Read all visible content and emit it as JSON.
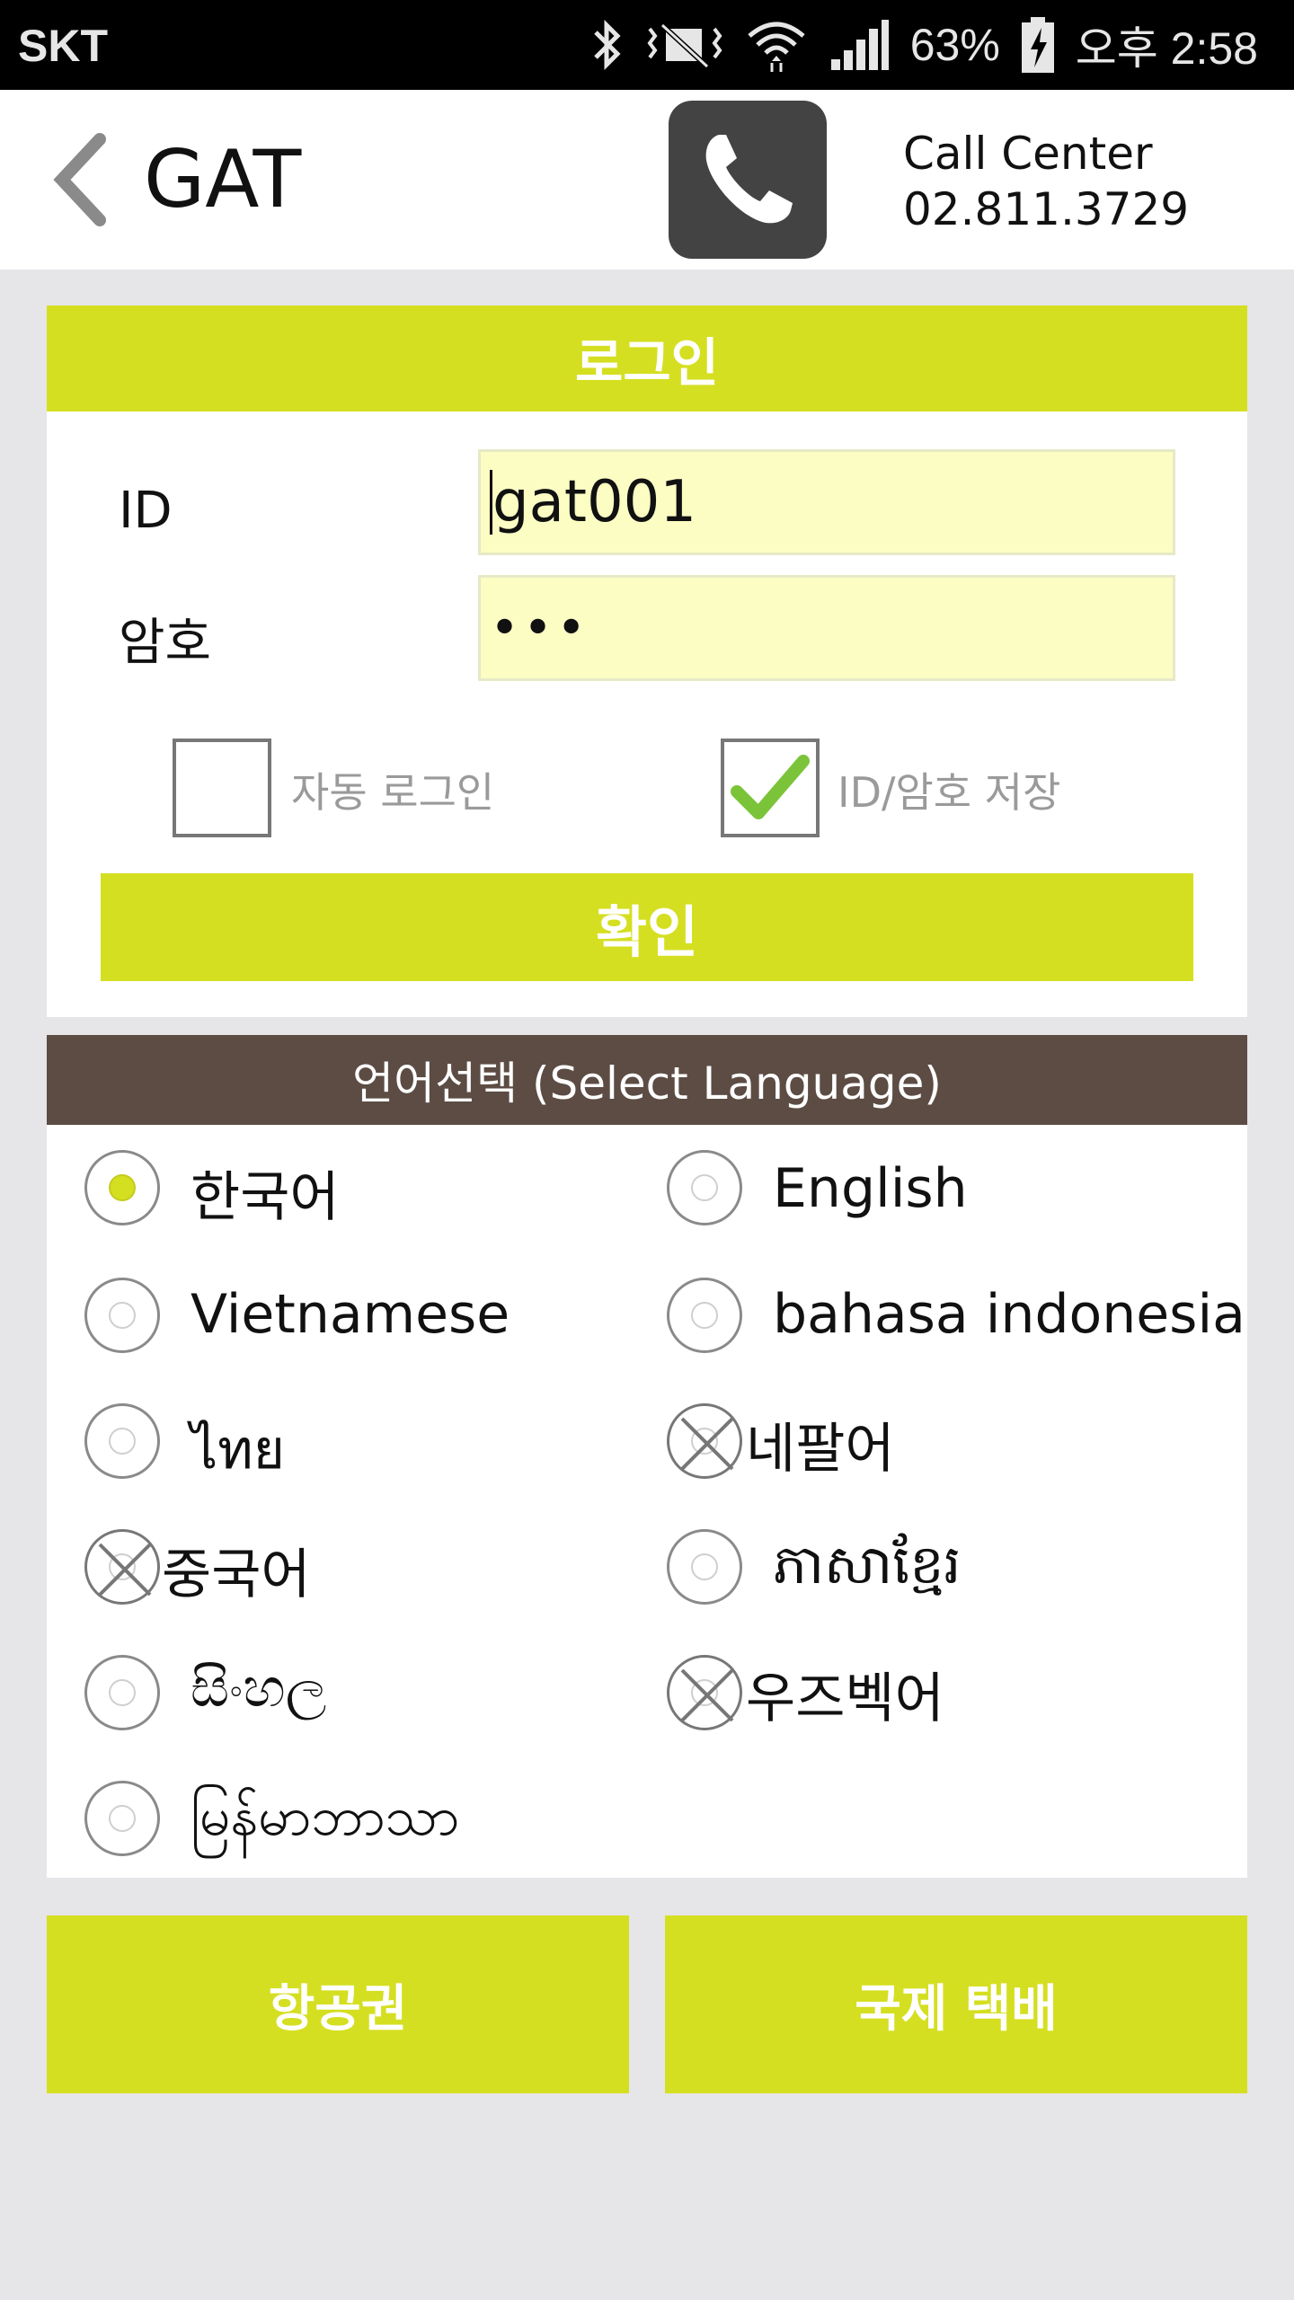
{
  "status_bar": {
    "carrier": "SKT",
    "battery": "63%",
    "time": "오후 2:58",
    "icons": [
      "bluetooth-icon",
      "vibrate-icon",
      "mute-icon",
      "wifi-icon",
      "signal-icon",
      "battery-icon"
    ]
  },
  "header": {
    "title": "GAT",
    "call_center_label": "Call Center",
    "call_center_number": "02.811.3729",
    "phone_icon": "phone-icon"
  },
  "login": {
    "title": "로그인",
    "id_label": "ID",
    "id_value": "gat001",
    "password_label": "암호",
    "password_value": "•••",
    "auto_login_label": "자동 로그인",
    "auto_login_checked": false,
    "save_label": "ID/암호 저장",
    "save_checked": true,
    "confirm_label": "확인"
  },
  "language": {
    "title": "언어선택 (Select Language)",
    "options": [
      {
        "label": "한국어",
        "state": "selected"
      },
      {
        "label": "English",
        "state": "normal"
      },
      {
        "label": "Vietnamese",
        "state": "normal"
      },
      {
        "label": "bahasa indonesia",
        "state": "normal"
      },
      {
        "label": "ไทย",
        "state": "normal"
      },
      {
        "label": "네팔어",
        "state": "disabled"
      },
      {
        "label": "중국어",
        "state": "disabled"
      },
      {
        "label": "ភាសាខ្មែរ",
        "state": "normal"
      },
      {
        "label": "සිංහල",
        "state": "normal"
      },
      {
        "label": "우즈벡어",
        "state": "disabled"
      },
      {
        "label": "မြန်မာဘာသာ",
        "state": "normal"
      }
    ]
  },
  "bottom_buttons": {
    "left_label": "항공권",
    "right_label": "국제 택배"
  },
  "colors": {
    "accent": "#d5df21",
    "lang_header": "#5c4c44",
    "input_bg": "#fbfdc3",
    "page_bg": "#e6e5e8",
    "phone_button": "#434343"
  }
}
